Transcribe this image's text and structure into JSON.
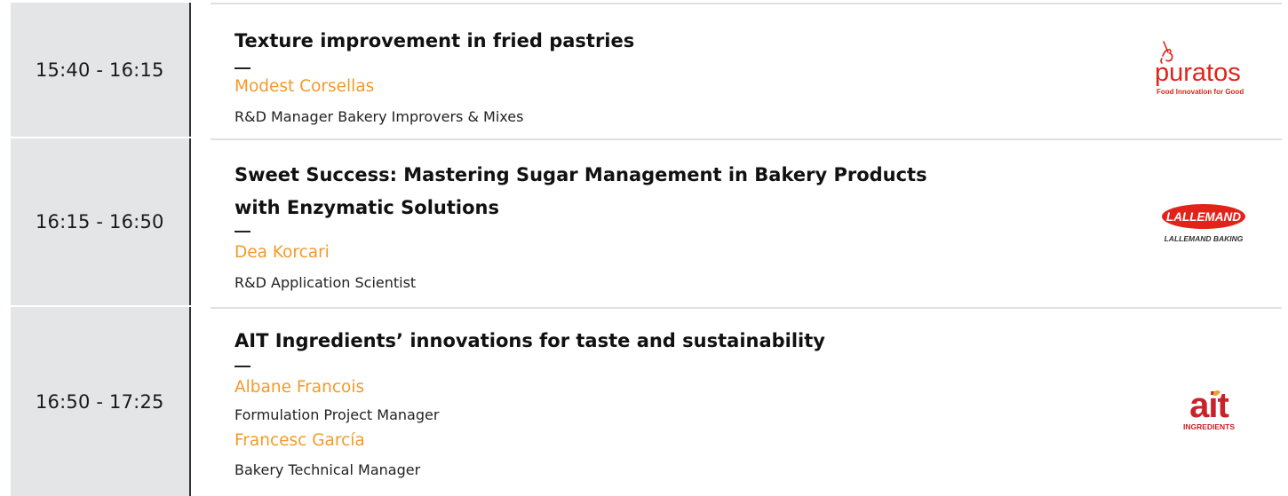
{
  "sessions": [
    {
      "time": "15:40 - 16:15",
      "title_lines": [
        "Texture improvement in fried pastries"
      ],
      "speakers": [
        {
          "name": "Modest Corsellas",
          "role": "R&D Manager Bakery Improvers & Mixes"
        }
      ],
      "logo": {
        "icon": "unicorn-icon",
        "wordmark": "puratos",
        "tagline": "Food Innovation for Good",
        "color": "#e2231a"
      }
    },
    {
      "time": "16:15 - 16:50",
      "title_lines": [
        "Sweet Success: Mastering Sugar Management in Bakery Products",
        "with Enzymatic Solutions"
      ],
      "speakers": [
        {
          "name": "Dea Korcari",
          "role": "R&D Application Scientist"
        }
      ],
      "logo": {
        "wordmark": "LALLEMAND",
        "tagline": "LALLEMAND BAKING",
        "color": "#e2231a"
      }
    },
    {
      "time": "16:50 - 17:25",
      "title_lines": [
        "AIT Ingredients’ innovations for taste and sustainability"
      ],
      "speakers": [
        {
          "name": "Albane Francois",
          "role": "Formulation Project Manager"
        },
        {
          "name": "Francesc García",
          "role": "Bakery Technical Manager"
        }
      ],
      "logo": {
        "wordmark": "ait",
        "tagline": "INGREDIENTS",
        "color": "#c8222a",
        "accent": "#e8a531"
      }
    }
  ],
  "colors": {
    "speaker_name": "#f39a2a",
    "time_cell": "#e4e5e7",
    "divider": "#333333"
  }
}
